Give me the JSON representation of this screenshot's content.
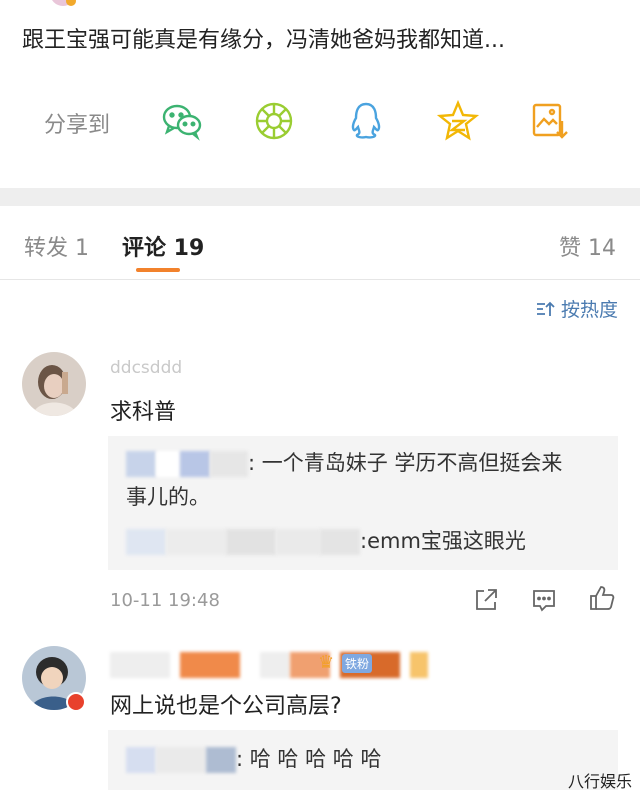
{
  "post": {
    "title": "跟王宝强可能真是有缘分，冯清她爸妈我都知道..."
  },
  "share": {
    "label": "分享到",
    "icons": [
      "wechat-icon",
      "moments-icon",
      "qq-icon",
      "qzone-icon",
      "save-image-icon"
    ]
  },
  "tabs": {
    "repost": "转发 1",
    "comments": "评论 19",
    "likes": "赞 14"
  },
  "sort": {
    "label": "按热度"
  },
  "comments": [
    {
      "username": "ddcsddd",
      "text": "求科普",
      "replies": [
        {
          "text_a": ": 一个青岛妹子 学历不高但挺会来",
          "text_b": "事儿的。"
        },
        {
          "text": ":emm宝强这眼光"
        }
      ],
      "time": "10-11 19:48"
    },
    {
      "text": "网上说也是个公司高层?",
      "badge": "铁粉",
      "replies": [
        {
          "text": ": 哈 哈 哈 哈 哈"
        }
      ]
    }
  ],
  "watermark": "八行娱乐",
  "colors": {
    "accent": "#f2822c",
    "link": "#4b7bb0",
    "wechat": "#3cb371",
    "moments": "#9acd32",
    "qq": "#4aa3df",
    "qzone": "#f2b705",
    "save": "#f0a020"
  }
}
